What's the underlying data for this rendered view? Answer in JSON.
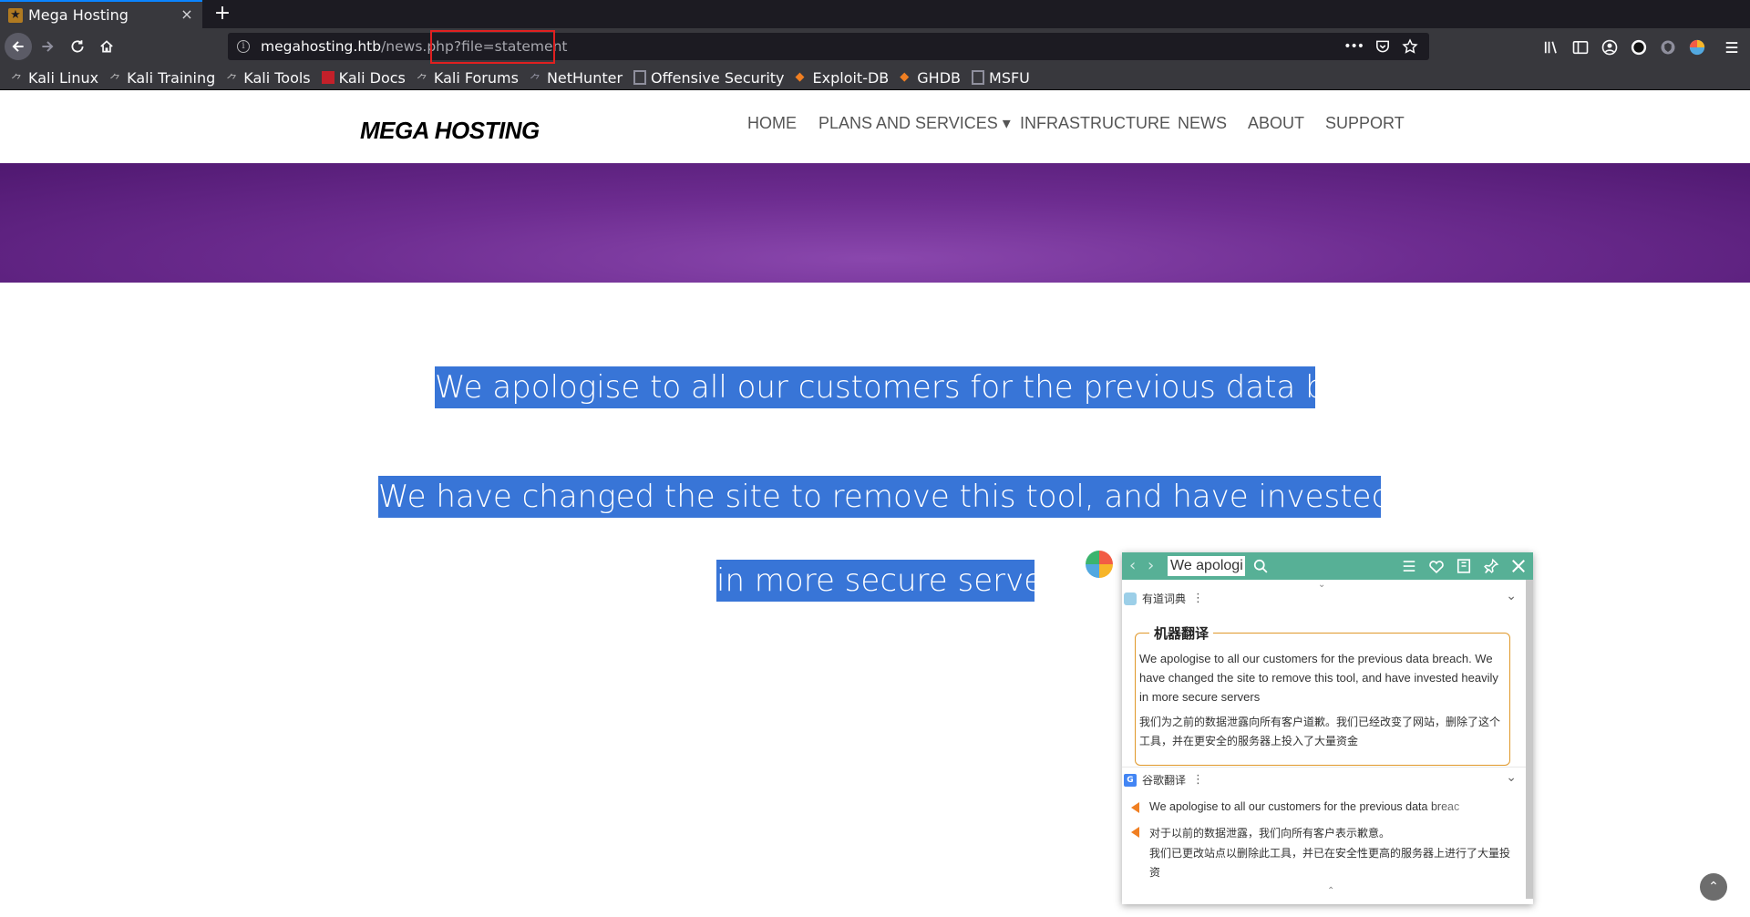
{
  "browser": {
    "tab_title": "Mega Hosting",
    "new_tab": "+",
    "close_tab": "×",
    "url_host": "megahosting.htb",
    "url_path": "/news.php",
    "url_query": "?file=statement",
    "page_actions": "•••"
  },
  "bookmarks": [
    {
      "label": "Kali Linux",
      "icon": "kali-dragon-icon"
    },
    {
      "label": "Kali Training",
      "icon": "kali-dragon-icon"
    },
    {
      "label": "Kali Tools",
      "icon": "kali-dragon-icon"
    },
    {
      "label": "Kali Docs",
      "icon": "kali-docs-icon"
    },
    {
      "label": "Kali Forums",
      "icon": "kali-dragon-icon"
    },
    {
      "label": "NetHunter",
      "icon": "nethunter-icon"
    },
    {
      "label": "Offensive Security",
      "icon": "offsec-icon"
    },
    {
      "label": "Exploit-DB",
      "icon": "exploit-db-icon"
    },
    {
      "label": "GHDB",
      "icon": "ghdb-icon"
    },
    {
      "label": "MSFU",
      "icon": "msfu-icon"
    }
  ],
  "site": {
    "logo": "MEGA HOSTING",
    "nav": [
      "HOME",
      "PLANS AND SERVICES ▾",
      "INFRASTRUCTURE",
      "NEWS",
      "ABOUT",
      "SUPPORT"
    ],
    "hero_color": "#6d2c90",
    "statement_line1": "We apologise to all our customers for the previous data breach.",
    "statement_line2": "We have changed the site to remove this tool, and have invested heavily",
    "statement_line3": "in more secure servers",
    "selection_color": "#3875d7"
  },
  "translator": {
    "search_value": "We apologi",
    "youdao_section": "有道词典",
    "machine_translation_title": "机器翻译",
    "mt_source": "We apologise to all our customers for the previous data breach. We have changed the site to remove this tool, and have invested heavily in more secure servers",
    "mt_target": "我们为之前的数据泄露向所有客户道歉。我们已经改变了网站，删除了这个工具，并在更安全的服务器上投入了大量资金",
    "google_section": "谷歌翻译",
    "g_source": "We apologise to all our customers for the previous data breac",
    "g_target1": "对于以前的数据泄露，我们向所有客户表示歉意。",
    "g_target2": "我们已更改站点以删除此工具，并已在安全性更高的服务器上进行了大量投资",
    "accent_color": "#57b096"
  }
}
